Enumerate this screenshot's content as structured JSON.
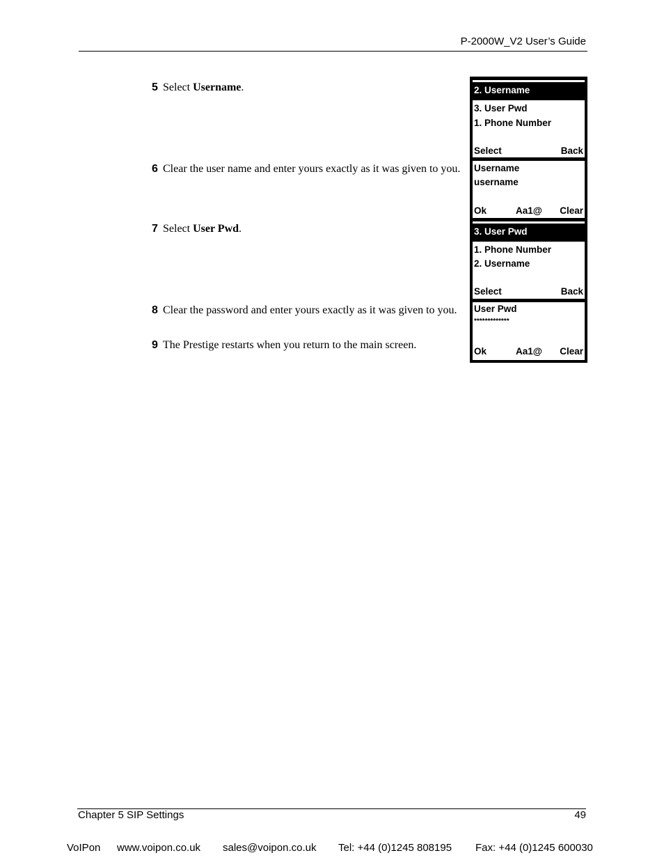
{
  "header": {
    "guide_title": "P-2000W_V2 User’s Guide"
  },
  "steps": [
    {
      "number": "5",
      "pre": "Select ",
      "bold": "Username",
      "post": "."
    },
    {
      "number": "6",
      "text": "Clear the user name and enter yours exactly as it was given to you."
    },
    {
      "number": "7",
      "pre": "Select ",
      "bold": "User Pwd",
      "post": "."
    },
    {
      "number": "8",
      "text": "Clear the password and enter yours exactly as it was given to you."
    },
    {
      "number": "9",
      "text": "The Prestige restarts when you return to the main screen."
    }
  ],
  "phone_screens": [
    {
      "selected": "2. Username",
      "lines": [
        "3. User Pwd",
        "1. Phone Number"
      ],
      "softkeys": {
        "left": "Select",
        "right": "Back"
      }
    },
    {
      "lines": [
        "Username",
        "username"
      ],
      "softkeys": {
        "left": "Ok",
        "center": "Aa1@",
        "right": "Clear"
      }
    },
    {
      "selected": "3. User Pwd",
      "lines": [
        "1. Phone Number",
        "2. Username"
      ],
      "softkeys": {
        "left": "Select",
        "right": "Back"
      }
    },
    {
      "lines": [
        "User Pwd",
        "*************"
      ],
      "softkeys": {
        "left": "Ok",
        "center": "Aa1@",
        "right": "Clear"
      }
    }
  ],
  "footer": {
    "chapter": "Chapter 5 SIP Settings",
    "page_number": "49",
    "company": "VoIPon",
    "website": "www.voipon.co.uk",
    "email": "sales@voipon.co.uk",
    "tel": "Tel: +44 (0)1245 808195",
    "fax": "Fax: +44 (0)1245 600030"
  }
}
